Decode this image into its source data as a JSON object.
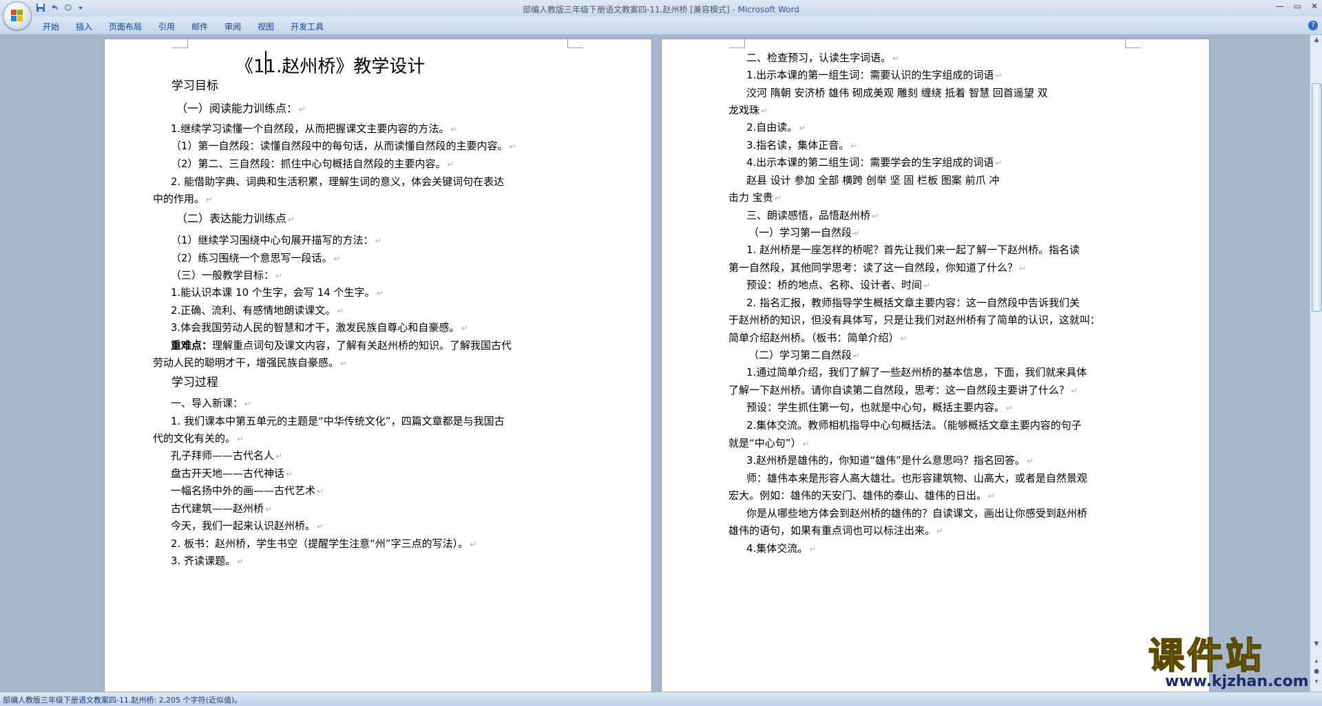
{
  "window": {
    "title_doc": "部编人教版三年级下册语文教案四-11.赵州桥 [兼容模式] - ",
    "title_app": "Microsoft Word",
    "controls": [
      "—",
      "▭",
      "✕"
    ]
  },
  "ribbon": {
    "tabs": [
      "开始",
      "插入",
      "页面布局",
      "引用",
      "邮件",
      "审阅",
      "视图",
      "开发工具"
    ],
    "help": "?"
  },
  "quick_access": [
    "save-icon",
    "undo-icon",
    "redo-icon",
    "customize-icon"
  ],
  "page_left": {
    "lines": [
      "《11.赵州桥》教学设计",
      "学习目标",
      "（一）阅读能力训练点：",
      "1.继续学习读懂一个自然段，从而把握课文主要内容的方法。",
      "（1）第一自然段：读懂自然段中的每句话，从而读懂自然段的主要内容。",
      "（2）第二、三自然段：抓住中心句概括自然段的主要内容。",
      "2. 能借助字典、词典和生活积累，理解生词的意义，体会关键词句在表达",
      "中的作用。",
      "（二）表达能力训练点",
      "（1）继续学习围绕中心句展开描写的方法：",
      "（2）练习围绕一个意思写一段话。",
      "（三）一般教学目标：",
      "1.能认识本课 10 个生字，会写 14 个生字。",
      "2.正确、流利、有感情地朗读课文。",
      "3.体会我国劳动人民的智慧和才干，激发民族自尊心和自豪感。",
      "理解重点词句及课文内容，了解有关赵州桥的知识。了解我国古代",
      "劳动人民的聪明才干，增强民族自豪感。",
      "学习过程",
      "一、导入新课：",
      "1. 我们课本中第五单元的主题是“中华传统文化”，四篇文章都是与我国古",
      "代的文化有关的。",
      "孔子拜师——古代名人",
      "盘古开天地——古代神话",
      "一幅名扬中外的画——古代艺术",
      "古代建筑——赵州桥",
      "今天，我们一起来认识赵州桥。",
      "2. 板书：赵州桥，学生书空（提醒学生注意“州”字三点的写法）。",
      "3. 齐读课题。"
    ],
    "bold_prefix": "重难点："
  },
  "page_right": {
    "lines": [
      "二、检查预习，认读生字词语。",
      "1.出示本课的第一组生词：需要认识的生字组成的词语",
      "洨河  隋朝  安济桥  雄伟  砌成美观    雕刻  缠绕  抵着    智慧    回首遥望  双",
      "龙戏珠",
      "2.自由读。",
      "3.指名读，集体正音。",
      "4.出示本课的第二组生词：需要学会的生字组成的词语",
      "赵县    设计    参加    全部      横跨    创举    坚 固    栏板    图案    前爪    冲",
      "击力    宝贵",
      "三、朗读感悟，品悟赵州桥",
      "（一）学习第一自然段",
      "1.  赵州桥是一座怎样的桥呢？首先让我们来一起了解一下赵州桥。指名读",
      "第一自然段，其他同学思考：读了这一自然段，你知道了什么？",
      "预设：桥的地点、名称、设计者、时间",
      "2.  指名汇报，教师指导学生概括文章主要内容：这一自然段中告诉我们关",
      "于赵州桥的知识，但没有具体写，只是让我们对赵州桥有了简单的认识，这就叫：",
      "简单介绍赵州桥。（板书：简单介绍）",
      "（二）学习第二自然段",
      "1.通过简单介绍，我们了解了一些赵州桥的基本信息，下面，我们就来具体",
      "了解一下赵州桥。请你自读第二自然段，思考：这一自然段主要讲了什么？",
      "预设：学生抓住第一句，也就是中心句，概括主要内容。",
      "2.集体交流。教师相机指导中心句概括法。（能够概括文章主要内容的句子",
      "就是“中心句”）",
      "3.赵州桥是雄伟的，你知道“雄伟”是什么意思吗？指名回答。",
      "师：雄伟本来是形容人高大雄壮。也形容建筑物、山高大，或者是自然景观",
      "宏大。例如：雄伟的天安门、雄伟的泰山、雄伟的日出。",
      "你是从哪些地方体会到赵州桥的雄伟的？自读课文，画出让你感受到赵州桥",
      "雄伟的语句，如果有重点词也可以标注出来。",
      "4.集体交流。"
    ]
  },
  "paragraph_mark": "↵",
  "statusbar": {
    "text": "部编人教版三年级下册语文教案四-11.赵州桥: 2,205 个字符(近似值)。"
  },
  "watermark": {
    "main": "课件站",
    "url": "www.kjzhan.com"
  },
  "colors": {
    "ribbon_text": "#15428b",
    "app_title": "#2c5aa0",
    "watermark_yellow": "#f1e20b",
    "watermark_url": "#1b2a6b"
  }
}
